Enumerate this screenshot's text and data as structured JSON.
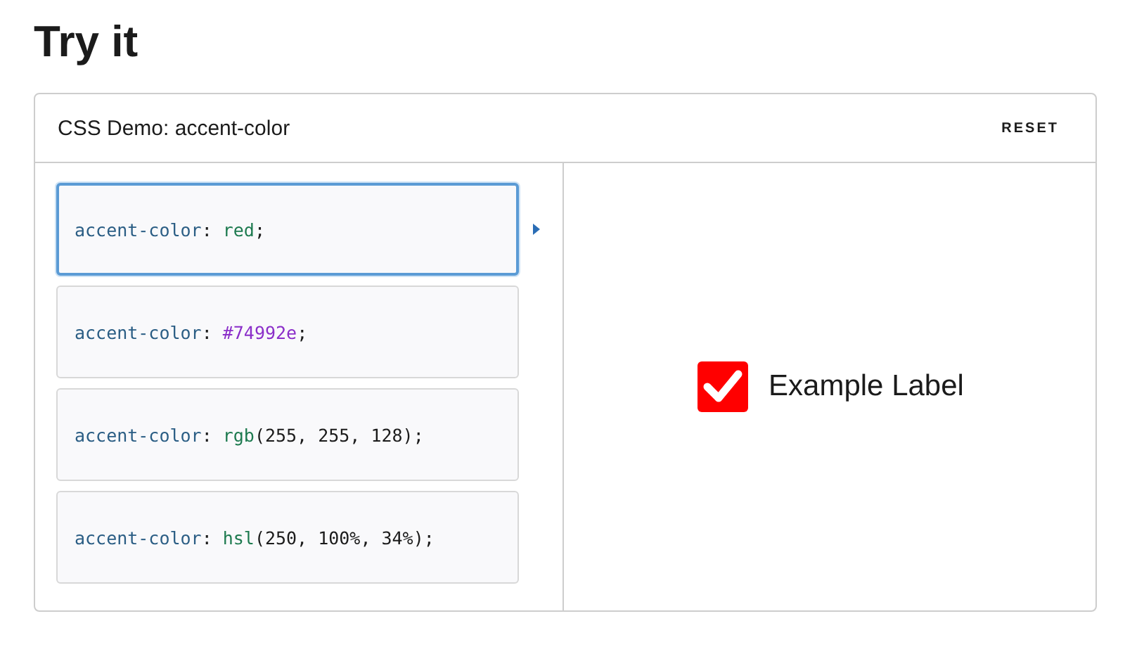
{
  "heading": "Try it",
  "demo": {
    "title": "CSS Demo: accent-color",
    "reset": "RESET",
    "options": [
      {
        "selected": true,
        "tokens": [
          {
            "text": "accent-color",
            "kind": "property"
          },
          {
            "text": ": ",
            "kind": "punct"
          },
          {
            "text": "red",
            "kind": "value"
          },
          {
            "text": ";",
            "kind": "punct"
          }
        ]
      },
      {
        "selected": false,
        "tokens": [
          {
            "text": "accent-color",
            "kind": "property"
          },
          {
            "text": ": ",
            "kind": "punct"
          },
          {
            "text": "#74992e",
            "kind": "hex"
          },
          {
            "text": ";",
            "kind": "punct"
          }
        ]
      },
      {
        "selected": false,
        "tokens": [
          {
            "text": "accent-color",
            "kind": "property"
          },
          {
            "text": ": ",
            "kind": "punct"
          },
          {
            "text": "rgb",
            "kind": "value"
          },
          {
            "text": "(255, 255, 128);",
            "kind": "punct"
          }
        ]
      },
      {
        "selected": false,
        "tokens": [
          {
            "text": "accent-color",
            "kind": "property"
          },
          {
            "text": ": ",
            "kind": "punct"
          },
          {
            "text": "hsl",
            "kind": "value"
          },
          {
            "text": "(250, 100%, 34%);",
            "kind": "punct"
          }
        ]
      }
    ],
    "output": {
      "checked": true,
      "label": "Example Label"
    }
  }
}
